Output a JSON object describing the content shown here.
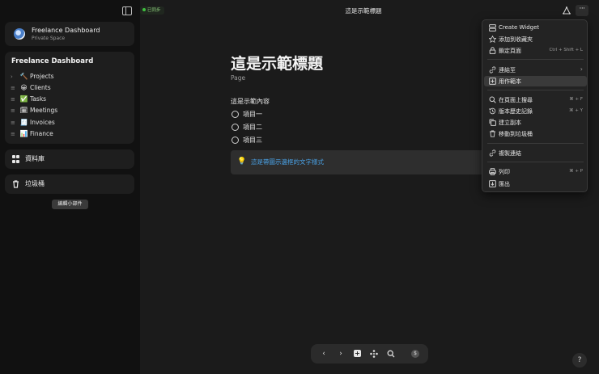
{
  "sidebar": {
    "space": {
      "name": "Freelance Dashboard",
      "subtitle": "Private Space"
    },
    "tree": {
      "title": "Freelance Dashboard",
      "items": [
        {
          "icon": "🔨",
          "label": "Projects",
          "caret": "›"
        },
        {
          "icon": "😀",
          "label": "Clients",
          "caret": "≡"
        },
        {
          "icon": "✅",
          "label": "Tasks",
          "caret": "≡"
        },
        {
          "icon": "🗓",
          "label": "Meetings",
          "caret": "≡"
        },
        {
          "icon": "🧾",
          "label": "Invoices",
          "caret": "≡"
        },
        {
          "icon": "📊",
          "label": "Finance",
          "caret": "≡"
        }
      ]
    },
    "database_label": "資料庫",
    "trash_label": "垃圾桶",
    "tooltip": "編輯小部件"
  },
  "header": {
    "sync_status": "已同步",
    "page_title": "這是示範標題"
  },
  "document": {
    "title": "這是示範標題",
    "subtitle": "Page",
    "intro": "這是示範內容",
    "todos": [
      "項目一",
      "項目二",
      "項目三"
    ],
    "callout_icon": "💡",
    "callout_text": "這是帶圖示邊框的文字樣式"
  },
  "menu": {
    "items": [
      {
        "label": "Create Widget",
        "shortcut": "",
        "icon": "widget-icon"
      },
      {
        "label": "添加到收藏夾",
        "shortcut": "",
        "icon": "star-icon"
      },
      {
        "label": "鎖定頁面",
        "shortcut": "Ctrl + Shift + L",
        "icon": "lock-icon"
      },
      {
        "label": "連結至",
        "shortcut": "",
        "icon": "link-icon"
      },
      {
        "label": "用作範本",
        "shortcut": "",
        "icon": "template-icon"
      },
      {
        "label": "在頁面上搜尋",
        "shortcut": "⌘ + F",
        "icon": "search-icon"
      },
      {
        "label": "版本歷史記錄",
        "shortcut": "⌘ + Y",
        "icon": "history-icon"
      },
      {
        "label": "建立副本",
        "shortcut": "",
        "icon": "copy-icon"
      },
      {
        "label": "移動到垃圾桶",
        "shortcut": "",
        "icon": "trash-icon"
      },
      {
        "label": "複製連結",
        "shortcut": "",
        "icon": "copy-link-icon"
      },
      {
        "label": "列印",
        "shortcut": "⌘ + P",
        "icon": "print-icon"
      },
      {
        "label": "匯出",
        "shortcut": "",
        "icon": "export-icon"
      }
    ]
  },
  "toolbar": {
    "back": "‹",
    "forward": "›",
    "add": "+",
    "dollar": "$"
  },
  "help": "?"
}
